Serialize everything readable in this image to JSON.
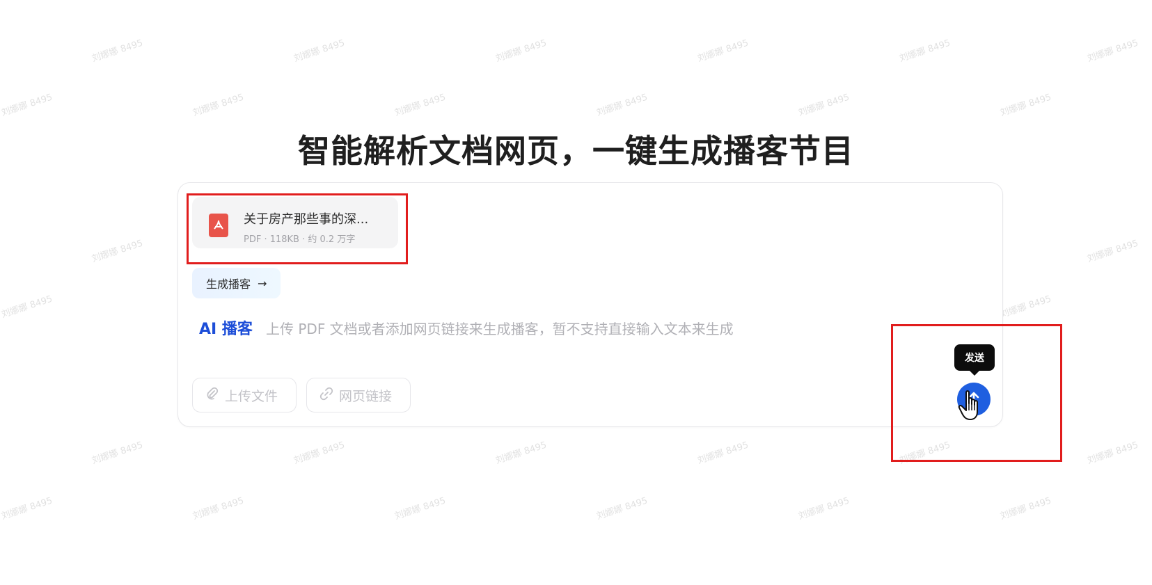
{
  "header": {
    "title": "智能解析文档网页，一键生成播客节目"
  },
  "watermark": {
    "text": "刘娜娜 8495"
  },
  "attachment": {
    "name": "关于房产那些事的深...",
    "meta": "PDF · 118KB · 约 0.2 万字",
    "icon": "pdf-icon"
  },
  "actions": {
    "generate_label": "生成播客",
    "generate_arrow": "→"
  },
  "input": {
    "mode_label": "AI 播客",
    "placeholder": "上传 PDF 文档或者添加网页链接来生成播客，暂不支持直接输入文本来生成"
  },
  "toolbar": {
    "upload_label": "上传文件",
    "link_label": "网页链接"
  },
  "send": {
    "tooltip": "发送",
    "icon": "arrow-up-icon"
  },
  "colors": {
    "accent_blue": "#1f5fe0",
    "highlight_red": "#e11d1d",
    "pdf_red": "#e8544a"
  }
}
